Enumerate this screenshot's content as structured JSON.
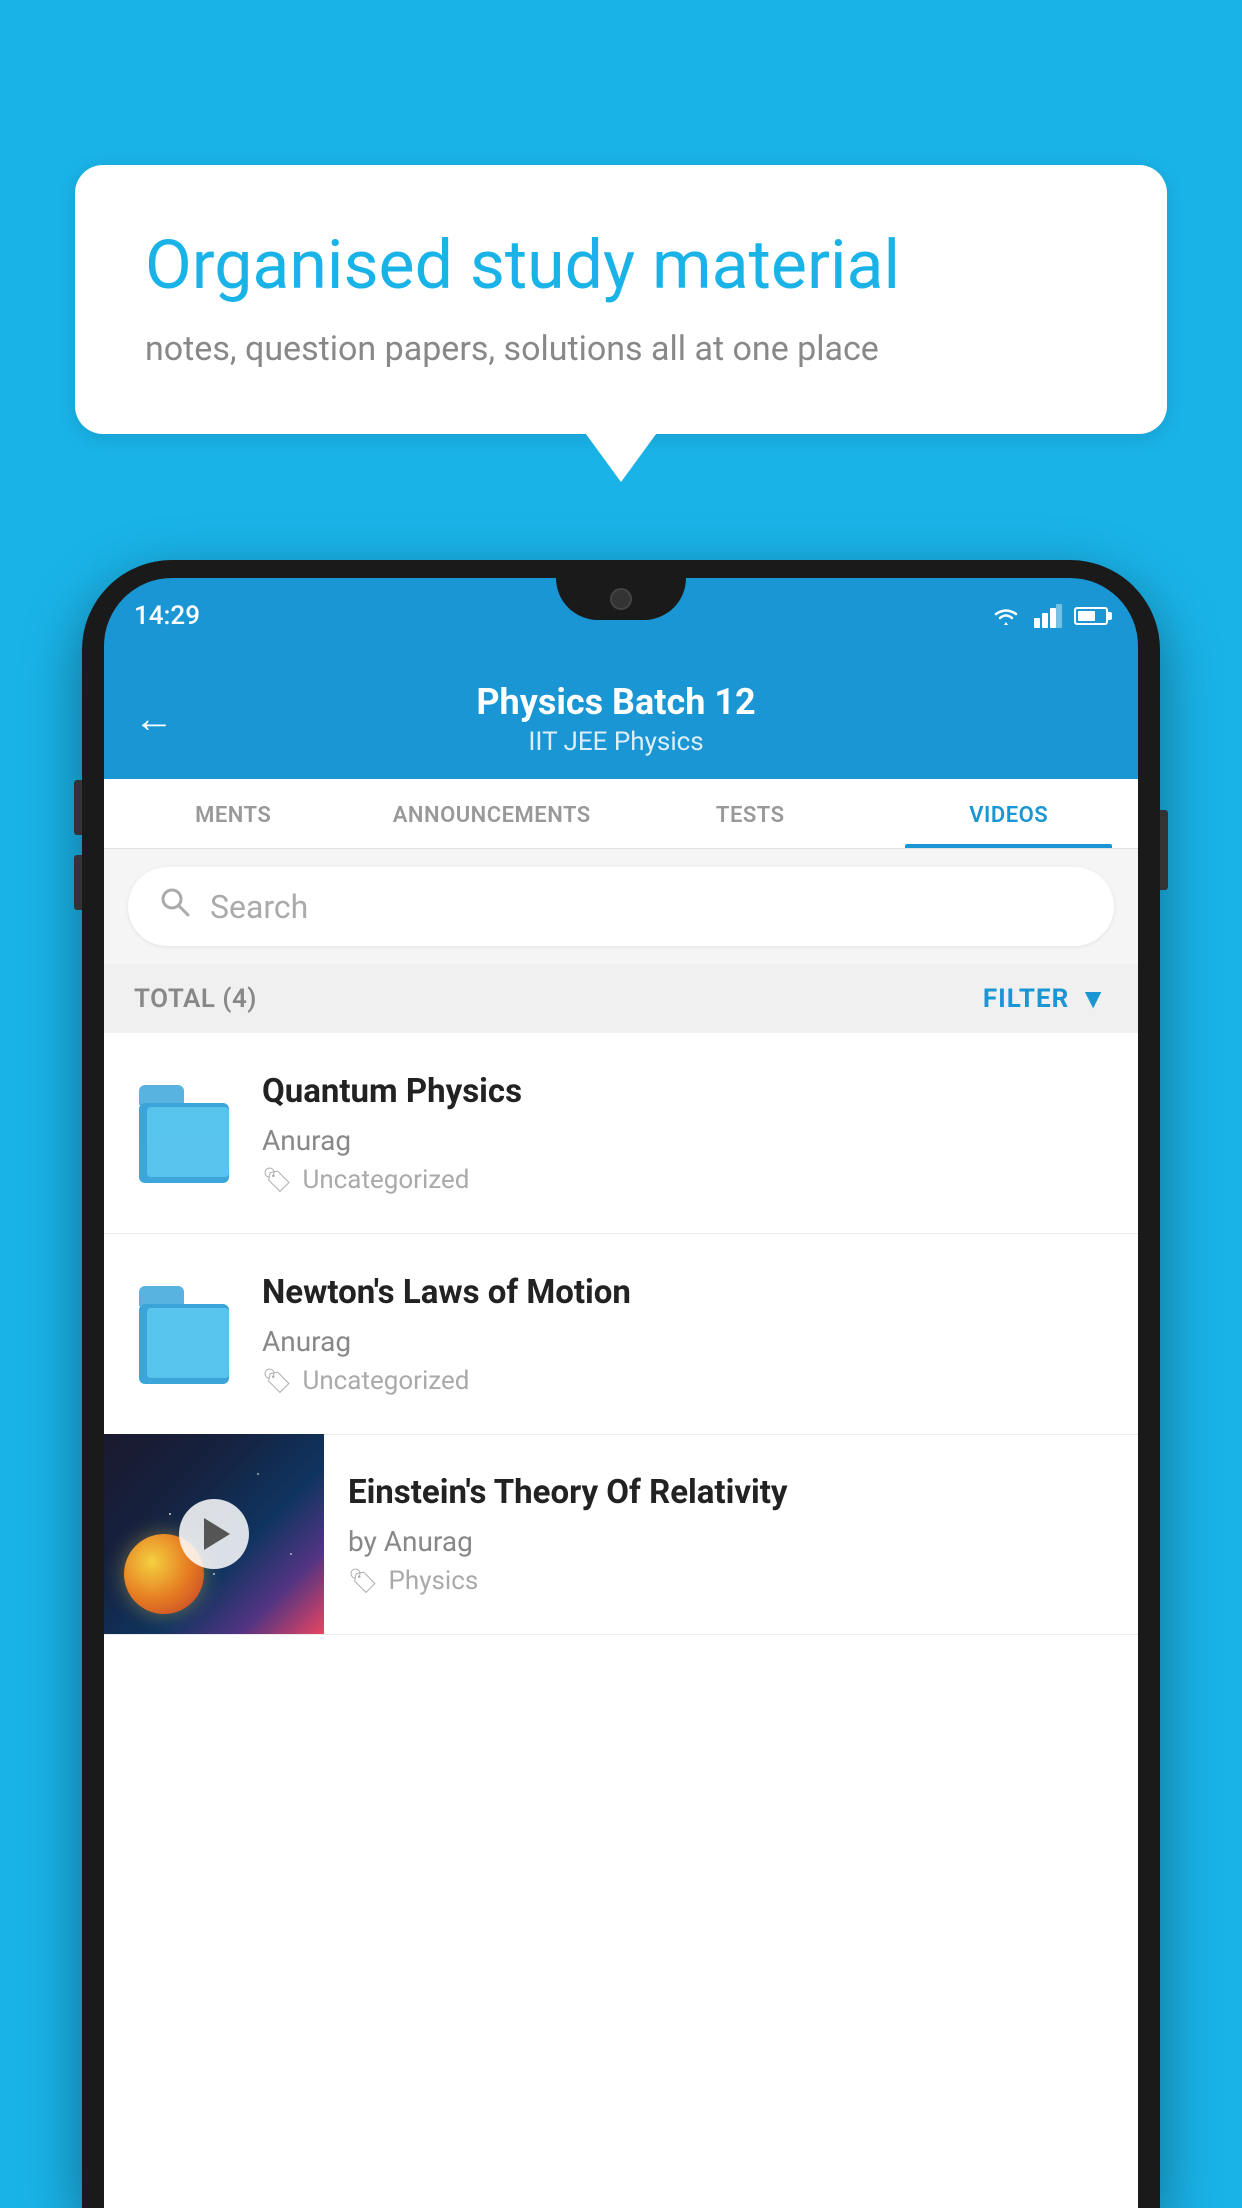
{
  "background": {
    "color": "#1ab3e8"
  },
  "speech_bubble": {
    "title": "Organised study material",
    "subtitle": "notes, question papers, solutions all at one place"
  },
  "phone": {
    "status_bar": {
      "time": "14:29"
    },
    "header": {
      "title": "Physics Batch 12",
      "subtitle": "IIT JEE   Physics",
      "back_label": "←"
    },
    "tabs": [
      {
        "label": "MENTS",
        "active": false
      },
      {
        "label": "ANNOUNCEMENTS",
        "active": false
      },
      {
        "label": "TESTS",
        "active": false
      },
      {
        "label": "VIDEOS",
        "active": true
      }
    ],
    "search": {
      "placeholder": "Search"
    },
    "filter_bar": {
      "total_label": "TOTAL (4)",
      "filter_label": "FILTER"
    },
    "videos": [
      {
        "title": "Quantum Physics",
        "author": "Anurag",
        "tag": "Uncategorized",
        "type": "folder"
      },
      {
        "title": "Newton's Laws of Motion",
        "author": "Anurag",
        "tag": "Uncategorized",
        "type": "folder"
      },
      {
        "title": "Einstein's Theory Of Relativity",
        "author": "by Anurag",
        "tag": "Physics",
        "type": "thumb"
      }
    ]
  }
}
